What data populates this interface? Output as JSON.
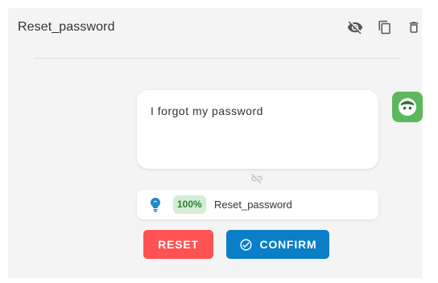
{
  "header": {
    "title": "Reset_password"
  },
  "message": {
    "text": "I forgot my password"
  },
  "intent": {
    "confidence": "100%",
    "label": "Reset_password"
  },
  "actions": {
    "reset_label": "RESET",
    "confirm_label": "CONFIRM"
  },
  "colors": {
    "avatar": "#5cb85c",
    "reset": "#ff5252",
    "confirm": "#0b7ec8",
    "badge_bg": "#d4edd4",
    "badge_text": "#2e7d32",
    "bulb": "#1e88c8"
  },
  "icons": {
    "visibility": "eye-off-icon",
    "copy": "copy-icon",
    "delete": "trash-icon",
    "avatar": "bot-face-icon",
    "unlink": "link-off-icon",
    "intent": "lightbulb-icon",
    "confirm": "check-circle-icon"
  }
}
